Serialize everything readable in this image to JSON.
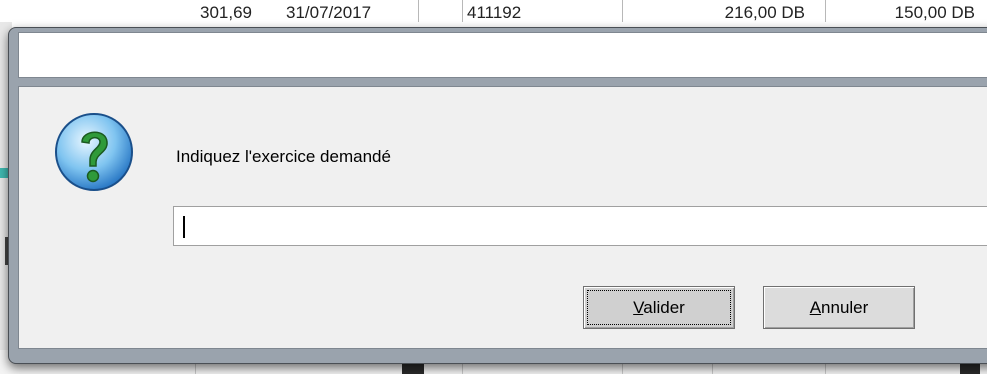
{
  "background": {
    "top_cells": [
      "301,69",
      "31/07/2017",
      "",
      "411192",
      "216,00 DB",
      "150,00 DB"
    ],
    "colors": {
      "teal": "#3fb8b0"
    }
  },
  "dialog": {
    "title": "",
    "icon": "question-icon",
    "prompt": "Indiquez l'exercice demandé",
    "input_value": "",
    "buttons": {
      "ok": {
        "mnemonic": "V",
        "rest": "alider"
      },
      "cancel": {
        "mnemonic": "A",
        "rest": "nnuler"
      }
    }
  }
}
